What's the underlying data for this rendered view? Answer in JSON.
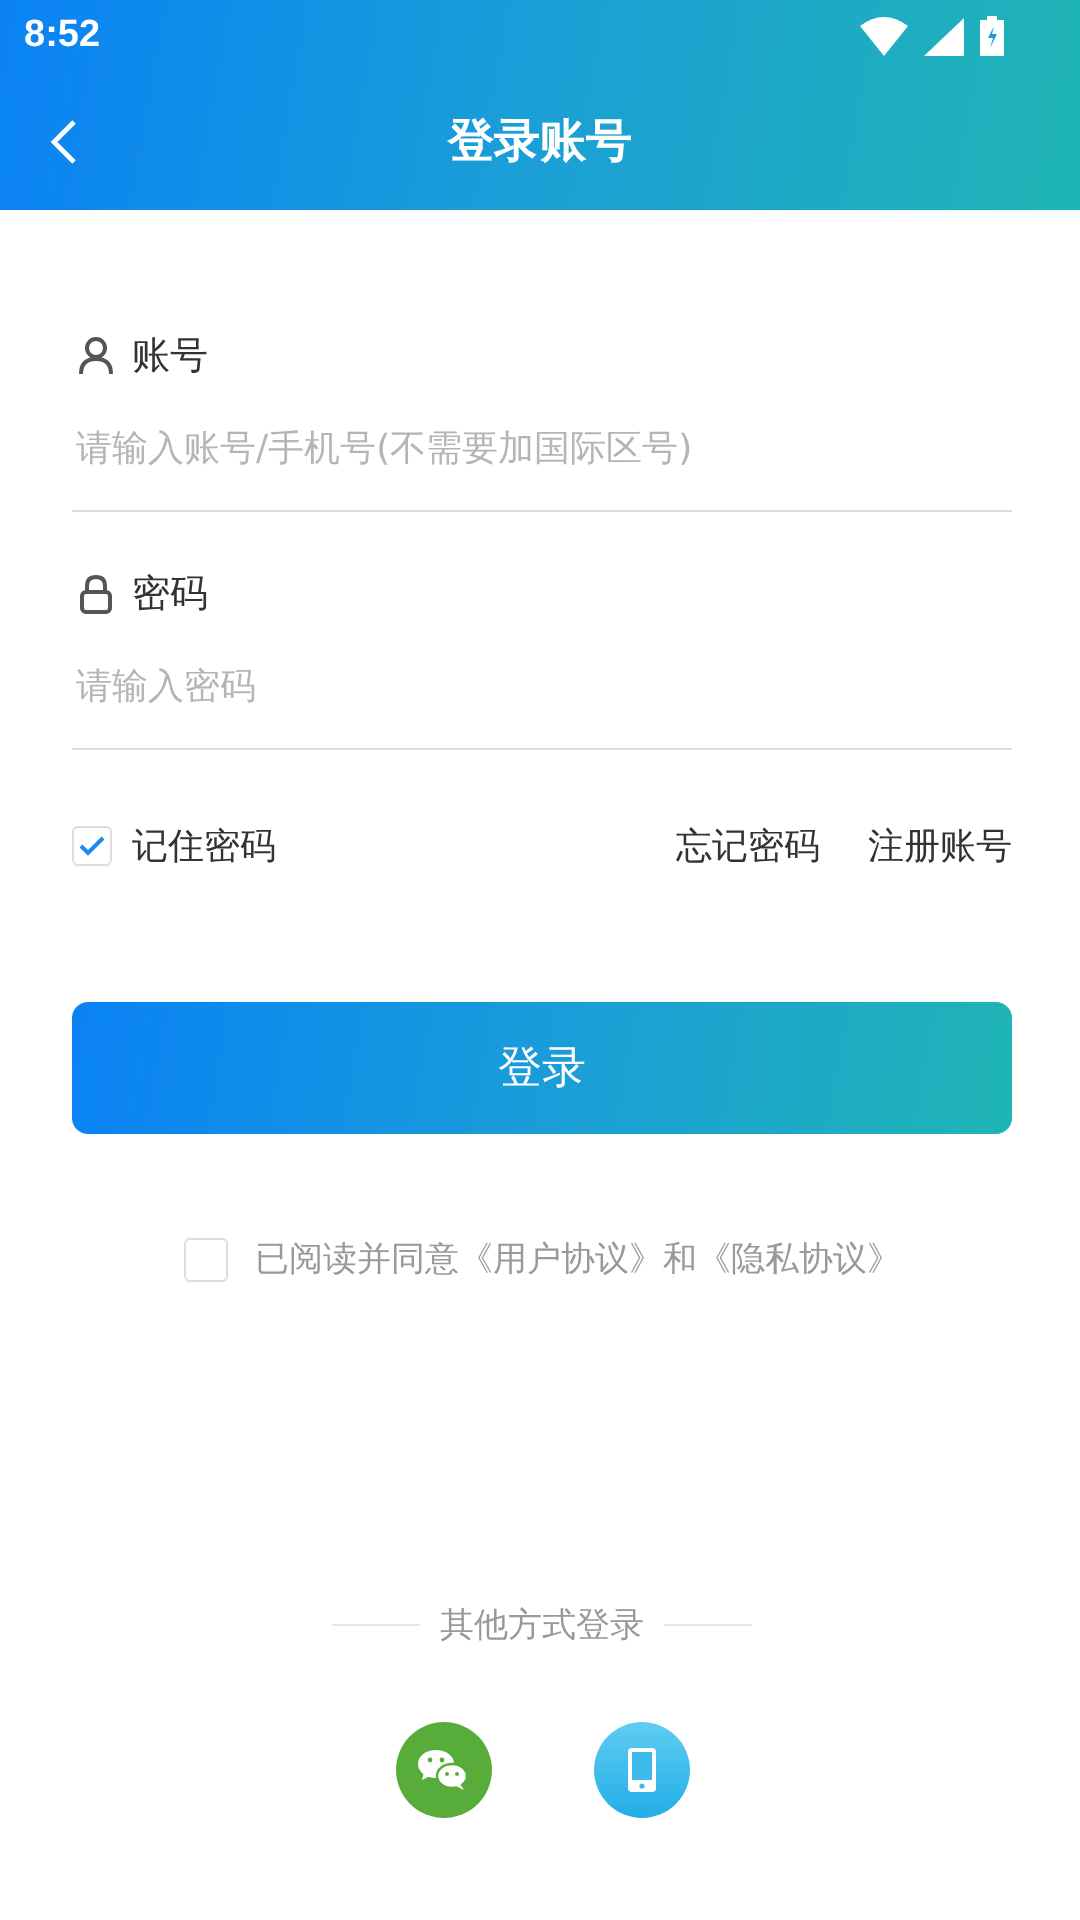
{
  "status_bar": {
    "time": "8:52"
  },
  "nav": {
    "title": "登录账号"
  },
  "account": {
    "label": "账号",
    "placeholder": "请输入账号/手机号(不需要加国际区号)"
  },
  "password": {
    "label": "密码",
    "placeholder": "请输入密码"
  },
  "remember": {
    "label": "记住密码",
    "checked": true
  },
  "links": [
    "忘记密码",
    "注册账号"
  ],
  "login_button": "登录",
  "agreement": {
    "text": "已阅读并同意《用户协议》和《隐私协议》",
    "checked": false
  },
  "other_login": {
    "label": "其他方式登录",
    "methods": [
      {
        "kind": "wechat"
      },
      {
        "kind": "phone"
      }
    ]
  }
}
